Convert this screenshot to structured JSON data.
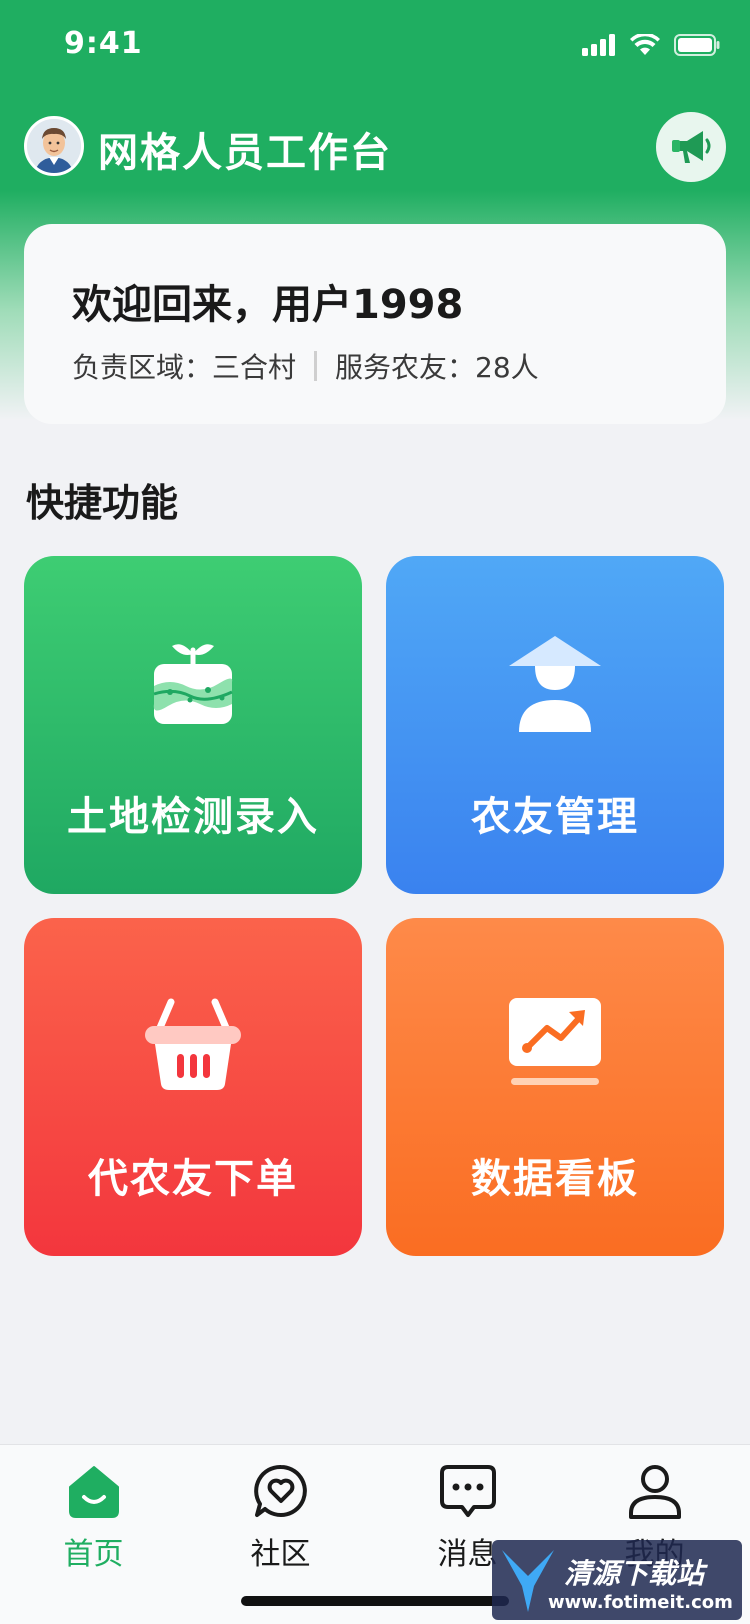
{
  "status_bar": {
    "time": "9:41"
  },
  "header": {
    "title": "网格人员工作台"
  },
  "welcome": {
    "title": "欢迎回来，用户1998",
    "region": "负责区域：三合村",
    "farmers": "服务农友：28人"
  },
  "quick": {
    "title": "快捷功能",
    "tiles": [
      {
        "label": "土地检测录入",
        "icon": "soil-plant-icon"
      },
      {
        "label": "农友管理",
        "icon": "farmer-hat-icon"
      },
      {
        "label": "代农友下单",
        "icon": "basket-icon"
      },
      {
        "label": "数据看板",
        "icon": "chart-board-icon"
      }
    ]
  },
  "nav": {
    "items": [
      {
        "label": "首页",
        "icon": "home-icon",
        "active": true
      },
      {
        "label": "社区",
        "icon": "heart-chat-icon"
      },
      {
        "label": "消息",
        "icon": "message-icon"
      },
      {
        "label": "我的",
        "icon": "user-icon"
      }
    ]
  },
  "watermark": {
    "text": "清源下载站",
    "url": "www.fotimeit.com"
  },
  "colors": {
    "brand_green": "#1fae61",
    "blue": "#3a82ef",
    "red": "#f3363d",
    "orange": "#fa6d22"
  }
}
